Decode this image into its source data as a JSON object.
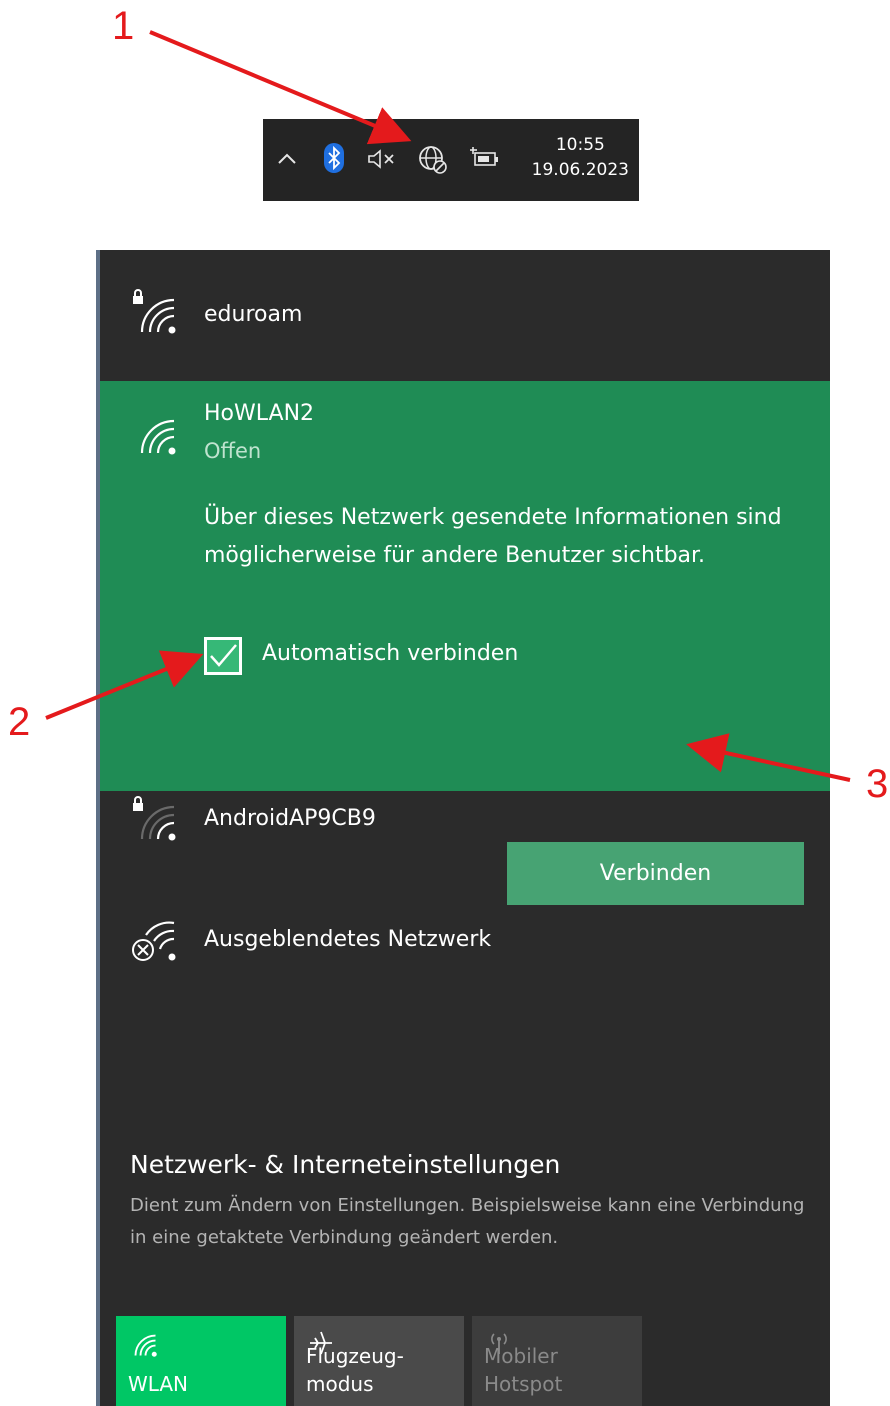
{
  "callouts": [
    "1",
    "2",
    "3"
  ],
  "taskbar": {
    "chevron_icon": "chevron-up-icon",
    "bluetooth_icon": "bluetooth-icon",
    "volume_icon": "volume-muted-icon",
    "network_icon": "globe-no-connection-icon",
    "battery_icon": "battery-charging-icon",
    "time": "10:55",
    "date": "19.06.2023"
  },
  "networks": [
    {
      "name": "eduroam",
      "secured": true
    },
    {
      "name": "HoWLAN2",
      "status": "Offen",
      "info": "Über dieses Netzwerk gesendete Informationen sind möglicherweise für andere Benutzer sichtbar.",
      "auto_connect_label": "Automatisch verbinden",
      "auto_connect_checked": true,
      "connect_label": "Verbinden"
    },
    {
      "name": "AndroidAP9CB9",
      "secured": true
    },
    {
      "name": "Ausgeblendetes Netzwerk"
    }
  ],
  "settings": {
    "title": "Netzwerk- & Interneteinstellungen",
    "description": "Dient zum Ändern von Einstellungen. Beispielsweise kann eine Verbindung in eine getaktete Verbindung geändert werden."
  },
  "quick_actions": [
    {
      "label": "WLAN",
      "icon": "wifi-icon",
      "active": true
    },
    {
      "label_line1": "Flugzeug-",
      "label_line2": "modus",
      "icon": "airplane-icon",
      "active": false
    },
    {
      "label_line1": "Mobiler",
      "label_line2": "Hotspot",
      "icon": "hotspot-icon",
      "active": false
    }
  ],
  "colors": {
    "panel_bg": "#2b2b2b",
    "selected_bg": "#1f8c55",
    "button_bg": "#47a373",
    "wlan_tile": "#00c765",
    "annotation_red": "#e41a1c"
  }
}
